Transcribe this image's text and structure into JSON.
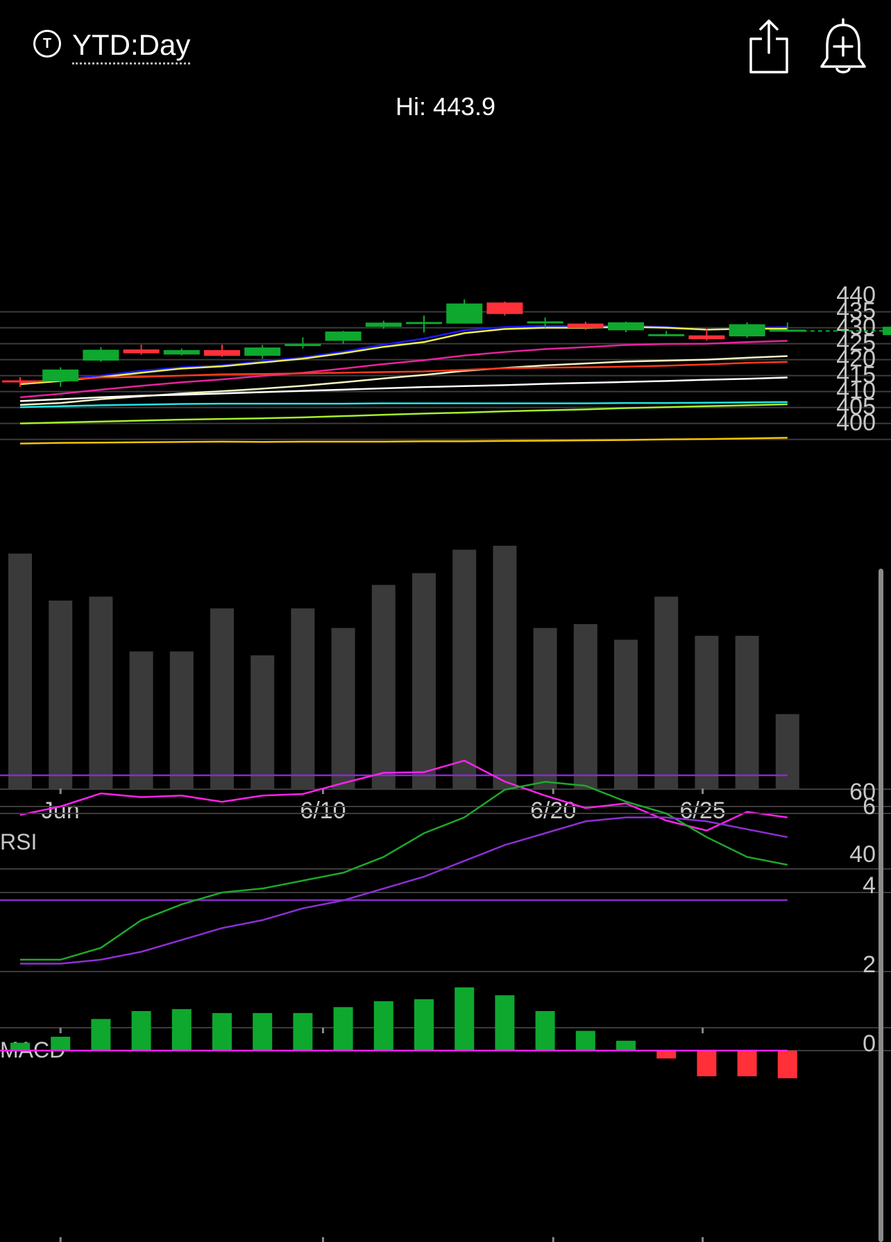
{
  "header": {
    "timeframe_icon": "T",
    "timeframe_label": "YTD:Day",
    "share_icon": "share-icon",
    "alert_icon": "add-alert-bell-icon"
  },
  "hi_label": "Hi: 443.9",
  "chart_data": {
    "type": "candlestick",
    "price_axis": {
      "ticks": [
        440,
        435,
        430,
        425,
        420,
        415,
        410,
        405,
        400
      ],
      "range": [
        398,
        445
      ]
    },
    "date_axis": {
      "labels": [
        {
          "text": "Jun",
          "index": 1
        },
        {
          "text": "6/10",
          "index": 7.5
        },
        {
          "text": "6/20",
          "index": 13.2
        },
        {
          "text": "6/25",
          "index": 16.9
        }
      ]
    },
    "last_price": 434.0,
    "candles": [
      {
        "open": 418.5,
        "close": 418.0,
        "high": 419.5,
        "low": 416.5
      },
      {
        "open": 418.2,
        "close": 421.9,
        "high": 422.6,
        "low": 416.5
      },
      {
        "open": 424.7,
        "close": 428.1,
        "high": 428.9,
        "low": 424.3
      },
      {
        "open": 428.2,
        "close": 427.0,
        "high": 429.7,
        "low": 426.5
      },
      {
        "open": 426.6,
        "close": 428.0,
        "high": 428.5,
        "low": 426.3
      },
      {
        "open": 428.0,
        "close": 426.2,
        "high": 429.7,
        "low": 425.9
      },
      {
        "open": 426.2,
        "close": 428.8,
        "high": 429.6,
        "low": 425.3
      },
      {
        "open": 429.9,
        "close": 429.9,
        "high": 432.0,
        "low": 428.5
      },
      {
        "open": 430.9,
        "close": 433.8,
        "high": 434.0,
        "low": 430.0
      },
      {
        "open": 435.3,
        "close": 436.6,
        "high": 437.2,
        "low": 434.7
      },
      {
        "open": 436.8,
        "close": 436.8,
        "high": 438.8,
        "low": 433.5
      },
      {
        "open": 436.3,
        "close": 442.6,
        "high": 443.9,
        "low": 436.3
      },
      {
        "open": 442.9,
        "close": 439.3,
        "high": 443.2,
        "low": 438.8
      },
      {
        "open": 437.0,
        "close": 437.0,
        "high": 438.2,
        "low": 435.0
      },
      {
        "open": 436.3,
        "close": 434.9,
        "high": 436.9,
        "low": 434.3
      },
      {
        "open": 434.2,
        "close": 436.7,
        "high": 436.9,
        "low": 433.6
      },
      {
        "open": 433.0,
        "close": 433.0,
        "high": 434.0,
        "low": 432.3
      },
      {
        "open": 432.6,
        "close": 431.4,
        "high": 434.6,
        "low": 431.0
      },
      {
        "open": 432.3,
        "close": 436.1,
        "high": 436.7,
        "low": 431.8
      },
      {
        "open": 434.4,
        "close": 434.4,
        "high": 436.6,
        "low": 433.8
      }
    ],
    "volume_relative": [
      0.6,
      0.48,
      0.49,
      0.35,
      0.35,
      0.46,
      0.34,
      0.46,
      0.41,
      0.52,
      0.55,
      0.61,
      0.62,
      0.41,
      0.42,
      0.38,
      0.49,
      0.39,
      0.39,
      0.19
    ],
    "moving_averages": [
      {
        "color": "#1a1aff",
        "values": [
          417.6,
          418.6,
          420.0,
          421.5,
          422.6,
          423.2,
          424.5,
          425.7,
          427.5,
          429.7,
          431.6,
          434.2,
          435.2,
          435.6,
          435.5,
          435.7,
          435.2,
          434.4,
          435.0,
          435.2
        ]
      },
      {
        "color": "#f2f24a",
        "values": [
          417.3,
          418.3,
          419.5,
          420.9,
          422.2,
          422.9,
          424.1,
          425.3,
          427.0,
          429.0,
          430.5,
          433.3,
          434.6,
          435.0,
          435.0,
          435.3,
          435.0,
          434.4,
          434.7,
          434.7
        ]
      },
      {
        "color": "#e8229e",
        "values": [
          413.2,
          414.3,
          415.6,
          416.8,
          417.9,
          418.8,
          419.9,
          420.9,
          422.2,
          423.6,
          424.8,
          426.3,
          427.4,
          428.3,
          428.9,
          429.6,
          429.9,
          430.0,
          430.5,
          430.9
        ]
      },
      {
        "color": "#f4f4c4",
        "values": [
          410.8,
          411.4,
          412.6,
          413.5,
          414.4,
          415.1,
          415.9,
          416.8,
          417.9,
          419.1,
          420.2,
          421.5,
          422.4,
          423.2,
          423.8,
          424.4,
          424.7,
          425.0,
          425.6,
          426.1
        ]
      },
      {
        "color": "#ff3a1a",
        "values": [
          417.8,
          418.7,
          419.4,
          419.6,
          420.0,
          420.4,
          420.5,
          420.7,
          420.9,
          421.1,
          421.3,
          421.8,
          422.3,
          422.5,
          422.6,
          422.8,
          423.1,
          423.5,
          424.0,
          424.3
        ]
      },
      {
        "color": "#ffffff",
        "values": [
          412.0,
          412.6,
          413.2,
          413.7,
          414.0,
          414.4,
          414.8,
          415.2,
          415.6,
          416.0,
          416.4,
          416.7,
          417.0,
          417.4,
          417.7,
          418.0,
          418.3,
          418.7,
          419.0,
          419.4
        ]
      },
      {
        "color": "#22e6e6",
        "values": [
          410.1,
          410.4,
          410.7,
          410.9,
          411.1,
          411.2,
          411.2,
          411.2,
          411.2,
          411.3,
          411.3,
          411.3,
          411.3,
          411.3,
          411.3,
          411.4,
          411.4,
          411.5,
          411.6,
          411.7
        ]
      },
      {
        "color": "#a6f02a",
        "values": [
          405.0,
          405.3,
          405.6,
          405.9,
          406.2,
          406.4,
          406.6,
          406.9,
          407.3,
          407.7,
          408.1,
          408.4,
          408.8,
          409.1,
          409.4,
          409.8,
          410.1,
          410.4,
          410.7,
          411.0
        ]
      },
      {
        "color": "#f5c400",
        "values": [
          398.7,
          398.9,
          399.0,
          399.1,
          399.2,
          399.3,
          399.2,
          399.3,
          399.3,
          399.3,
          399.4,
          399.4,
          399.5,
          399.6,
          399.7,
          399.8,
          400.0,
          400.1,
          400.3,
          400.5
        ]
      }
    ],
    "rsi": {
      "label": "RSI",
      "ticks": [
        60,
        40
      ],
      "levels": [
        70,
        30
      ],
      "values": [
        57.3,
        60.0,
        64.2,
        63.0,
        63.5,
        61.5,
        63.5,
        64.0,
        67.5,
        70.8,
        71.0,
        74.7,
        68.0,
        63.5,
        59.5,
        61.0,
        55.5,
        52.3,
        58.3,
        56.5
      ]
    },
    "macd": {
      "label": "MACD",
      "ticks": [
        6,
        4,
        2,
        0
      ],
      "macd_line": [
        2.3,
        2.3,
        2.6,
        3.3,
        3.7,
        4.0,
        4.1,
        4.3,
        4.5,
        4.9,
        5.5,
        5.9,
        6.6,
        6.8,
        6.7,
        6.3,
        6.0,
        5.4,
        4.9,
        4.7
      ],
      "signal_line": [
        2.2,
        2.2,
        2.3,
        2.5,
        2.8,
        3.1,
        3.3,
        3.6,
        3.8,
        4.1,
        4.4,
        4.8,
        5.2,
        5.5,
        5.8,
        5.9,
        5.9,
        5.8,
        5.6,
        5.4
      ],
      "histogram": [
        0.2,
        0.35,
        0.8,
        1.0,
        1.05,
        0.95,
        0.95,
        0.95,
        1.1,
        1.25,
        1.3,
        1.6,
        1.4,
        1.0,
        0.5,
        0.25,
        -0.2,
        -0.65,
        -0.65,
        -0.7
      ]
    },
    "colors": {
      "up": "#0ea82e",
      "down": "#ff3038",
      "grid": "#3c3c3c",
      "volume": "#3a3a3a",
      "rsi_line": "#ff22ee",
      "rsi_band": "#8a2ad0",
      "macd_line": "#1ea82a",
      "signal_line": "#8e2fd6",
      "zero_line": "#ff22ee"
    }
  }
}
